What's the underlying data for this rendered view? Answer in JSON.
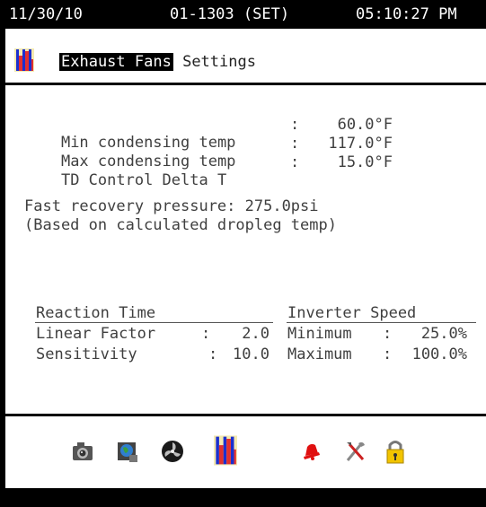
{
  "status": {
    "date": "11/30/10",
    "unit": "01-1303 (SET)",
    "time": "05:10:27 PM"
  },
  "title": {
    "selected": "Exhaust Fans",
    "rest": "Settings"
  },
  "settings": {
    "min_cond_label": "Min condensing temp",
    "min_cond_sep": ":",
    "min_cond_value": "60.0°F",
    "max_cond_label": "Max condensing temp",
    "max_cond_sep": ":",
    "max_cond_value": "117.0°F",
    "td_label": "TD Control Delta T",
    "td_sep": ":",
    "td_value": "15.0°F",
    "fast_recovery": "Fast recovery pressure: 275.0psi",
    "fast_recovery_note": "(Based on calculated dropleg temp)"
  },
  "reaction": {
    "header": "Reaction Time",
    "linear_label": "Linear Factor",
    "linear_sep": ":",
    "linear_value": "2.0",
    "sens_label": "Sensitivity",
    "sens_sep": ":",
    "sens_value": "10.0"
  },
  "inverter": {
    "header": "Inverter Speed",
    "min_label": "Minimum",
    "min_sep": ":",
    "min_value": "25.0%",
    "max_label": "Maximum",
    "max_sep": ":",
    "max_value": "100.0%"
  },
  "toolbar": {
    "icons": [
      "camera-icon",
      "globe-icon",
      "fan-icon",
      "bar-gauge-icon",
      "alarm-bell-icon",
      "tools-icon",
      "lock-icon"
    ]
  },
  "colors": {
    "background": "#ffffff",
    "bar": "#000000",
    "text": "#3f3f3f",
    "gauge_blue": "#1a2fd0",
    "gauge_yellow": "#f0d800",
    "alarm_red": "#e01010",
    "lock_yellow": "#f2c400"
  }
}
